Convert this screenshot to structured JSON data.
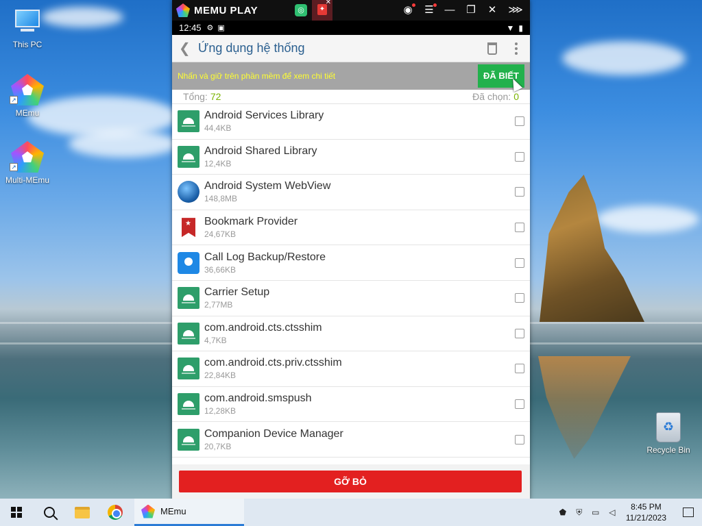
{
  "desktop": {
    "icons": [
      {
        "label": "This PC"
      },
      {
        "label": "MEmu"
      },
      {
        "label": "Multi-MEmu"
      },
      {
        "label": "Recycle Bin"
      }
    ]
  },
  "memu_window": {
    "brand": "MEMU PLAY",
    "buttons": {
      "account": "account-icon",
      "menu": "menu-icon",
      "minimize": "—",
      "restore": "❐",
      "close": "✕",
      "more": "⋙"
    }
  },
  "android": {
    "status_bar": {
      "time": "12:45"
    },
    "app_bar": {
      "title": "Ứng dụng hệ thống",
      "back_glyph": "❮"
    },
    "hint": {
      "text": "Nhấn và giữ trên phần mềm để xem chi tiết",
      "button": "ĐÃ BIẾT"
    },
    "counts": {
      "total_label": "Tổng:",
      "total_value": "72",
      "selected_label": "Đã chọn:",
      "selected_value": "0"
    },
    "apps": [
      {
        "name": "Android Services Library",
        "size": "44,4KB",
        "icon": "android"
      },
      {
        "name": "Android Shared Library",
        "size": "12,4KB",
        "icon": "android"
      },
      {
        "name": "Android System WebView",
        "size": "148,8MB",
        "icon": "globe"
      },
      {
        "name": "Bookmark Provider",
        "size": "24,67KB",
        "icon": "bookmark"
      },
      {
        "name": "Call Log Backup/Restore",
        "size": "36,66KB",
        "icon": "contact"
      },
      {
        "name": "Carrier Setup",
        "size": "2,77MB",
        "icon": "android"
      },
      {
        "name": "com.android.cts.ctsshim",
        "size": "4,7KB",
        "icon": "android"
      },
      {
        "name": "com.android.cts.priv.ctsshim",
        "size": "22,84KB",
        "icon": "android"
      },
      {
        "name": "com.android.smspush",
        "size": "12,28KB",
        "icon": "android"
      },
      {
        "name": "Companion Device Manager",
        "size": "20,7KB",
        "icon": "android"
      }
    ],
    "remove_button": "GỠ BỎ"
  },
  "taskbar": {
    "memu_label": "MEmu",
    "clock_time": "8:45 PM",
    "clock_date": "11/21/2023"
  },
  "colors": {
    "accent_green": "#22b14c",
    "remove_red": "#e32020",
    "hint_yellow": "#ffff30",
    "count_green": "#7ab300"
  }
}
